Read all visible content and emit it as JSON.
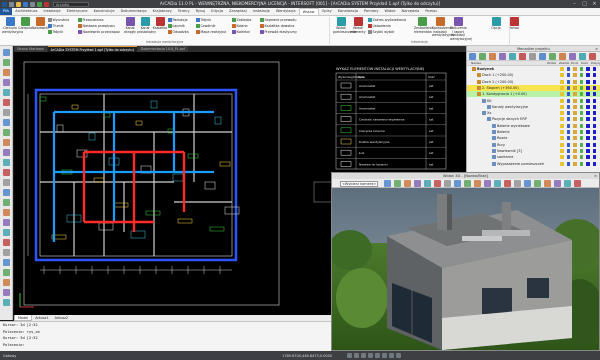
{
  "app": {
    "title": "ArCADia 11.0 PL - WEWNĘTRZNA, NIEKOMERCYJNA LICENCJA - INTERSOFT [001] - [ArCADia SYSTEM Przykład 1.apf (Tylko do odczytu)]",
    "search_value": "Arcadia"
  },
  "ribbon_tabs": [
    "Plik",
    "Architektura",
    "Instalacje",
    "Elektryczne",
    "Konstrukcje",
    "Dokumentacja",
    "Krajobrazy",
    "Tereny",
    "Rysuj",
    "Edycja",
    "Zarządzaj",
    "Instalacje",
    "Wentylacja",
    "Wstaw",
    "Opisy",
    "Kanalizacja",
    "Pomiary",
    "Widok",
    "Narzędzia",
    "Pomoc",
    "Inwentaryzacja",
    "Wymiarowanie",
    "Widok",
    "Pomoc",
    "Widok",
    "Wyświetlanie"
  ],
  "ribbon": {
    "buttons_left": [
      {
        "label": "Centrala wentylacyjna",
        "icon": "ventilation-unit-icon"
      },
      {
        "label": "Czerpnia",
        "icon": "air-intake-icon"
      },
      {
        "label": "Nawiewnik",
        "icon": "diffuser-icon"
      }
    ],
    "col1": [
      {
        "label": "Wyrzutnia",
        "icon": "exhaust-icon"
      },
      {
        "label": "Tłumik",
        "icon": "silencer-icon"
      },
      {
        "label": "Trójnik",
        "icon": "tee-icon"
      }
    ],
    "col2": [
      {
        "label": "Przepustnica",
        "icon": "damper-icon"
      },
      {
        "label": "Nastawa przepływu",
        "icon": "flow-setting-icon"
      },
      {
        "label": "Nawiewnik przeciwpożarowy",
        "icon": "fire-damper-icon"
      }
    ],
    "mid_buttons": [
      {
        "label": "Kanał okrągły",
        "icon": "round-duct-icon"
      },
      {
        "label": "Kanał prostokątny",
        "icon": "rect-duct-icon"
      },
      {
        "label": "Kształtka",
        "icon": "fitting-icon"
      }
    ],
    "col3": [
      {
        "label": "Redukcja",
        "icon": "reduction-icon"
      },
      {
        "label": "Łącznik",
        "icon": "connector-icon"
      },
      {
        "label": "Odsadzka",
        "icon": "offset-icon"
      }
    ],
    "col4": [
      {
        "label": "Trójnik",
        "icon": "tee2-icon"
      },
      {
        "label": "Czwórnik",
        "icon": "cross-icon"
      },
      {
        "label": "Mapa rewizyjna",
        "icon": "inspection-icon"
      }
    ],
    "col5": [
      {
        "label": "Zaślepka",
        "icon": "cap-icon"
      },
      {
        "label": "Kolano",
        "icon": "elbow-icon"
      },
      {
        "label": "Kolektor",
        "icon": "collector-icon"
      }
    ],
    "col6": [
      {
        "label": "Segment przewodu",
        "icon": "segment-icon"
      },
      {
        "label": "Kształtka dowolna",
        "icon": "custom-fitting-icon"
      },
      {
        "label": "Przewód elastyczny",
        "icon": "flexible-duct-icon"
      }
    ],
    "group_label_installation": "Instalacja wentylacyjna",
    "edit_buttons": [
      {
        "label": "Widok pomieszczenie",
        "icon": "room-view-icon"
      },
      {
        "label": "Widok elementy",
        "icon": "elements-view-icon"
      }
    ],
    "col7": [
      {
        "label": "Zakres wyświetlania",
        "icon": "display-range-icon"
      },
      {
        "label": "Ustawienia",
        "icon": "settings-icon"
      },
      {
        "label": "Szybki wybór",
        "icon": "quick-select-icon"
      }
    ],
    "right_buttons": [
      {
        "label": "Zestawienie elementów",
        "icon": "bill-icon"
      },
      {
        "label": "Sprawdzenie instalacji wentylacyjnej",
        "icon": "check-icon"
      },
      {
        "label": "Obliczenia i raport instalacji wentylacyjnej",
        "icon": "report-icon"
      },
      {
        "label": "Opcje",
        "icon": "options-icon"
      },
      {
        "label": "Pomoc",
        "icon": "help-icon"
      }
    ],
    "group_label_info": "Informacje"
  },
  "doc_tabs": [
    "Strona Startowa",
    "ArCADia SYSTEM Przykład 1.apf (Tylko do odczytu)",
    "Dokumentacja 10.0_PL.apf"
  ],
  "active_doc_tab": 1,
  "drawing": {
    "legend_title": "WYKAZ ELEMENTÓW INSTALACJI WENTYLACYJNEJ",
    "legend_headers": [
      "Wyszczególnienie",
      "Opis",
      "Ilość"
    ],
    "legend_rows": [
      {
        "desc": "Anemostat",
        "qty": "szt"
      },
      {
        "desc": "Anemostat",
        "qty": "szt"
      },
      {
        "desc": "Anemostat",
        "qty": "szt"
      },
      {
        "desc": "Centrala nawiewno-wywiewna",
        "qty": "szt"
      },
      {
        "desc": "Czerpnia ścienna",
        "qty": "szt"
      },
      {
        "desc": "Kratka wentylacyjna",
        "qty": "szt"
      },
      {
        "desc": "Łuk",
        "qty": "szt"
      },
      {
        "desc": "Nawiew do łazienki",
        "qty": "szt"
      }
    ]
  },
  "navigator": {
    "title": "Menadżer projektu",
    "columns": [
      "Nazwa",
      "Widok",
      "Zablok.",
      "Druk",
      "Kolor",
      "Pozycja"
    ],
    "tree": [
      {
        "label": "Budynek",
        "indent": 1,
        "style": "bold"
      },
      {
        "label": "Dach 1 (+200.00)",
        "indent": 2,
        "style": ""
      },
      {
        "label": "Dach 2 (+200.00)",
        "indent": 2,
        "style": ""
      },
      {
        "label": "2. Stopień (+360.00)",
        "indent": 2,
        "style": "sel"
      },
      {
        "label": "1. Kondygnacja 1 (+0.00)",
        "indent": 2,
        "style": "green"
      },
      {
        "label": "KK",
        "indent": 3,
        "style": ""
      },
      {
        "label": "Kanały wentylacyjne",
        "indent": 4,
        "style": ""
      },
      {
        "label": "Xx",
        "indent": 3,
        "style": ""
      },
      {
        "label": "Pozycje danych ERP",
        "indent": 4,
        "style": ""
      },
      {
        "label": "Baterie wyciekowe",
        "indent": 5,
        "style": ""
      },
      {
        "label": "Baterie",
        "indent": 5,
        "style": ""
      },
      {
        "label": "Rozdz",
        "indent": 5,
        "style": ""
      },
      {
        "label": "Rury",
        "indent": 5,
        "style": ""
      },
      {
        "label": "Nawiewnik [3]",
        "indent": 5,
        "style": ""
      },
      {
        "label": "sanitarne",
        "indent": 5,
        "style": ""
      },
      {
        "label": "Wyposażenie pomieszczeń",
        "indent": 5,
        "style": ""
      }
    ]
  },
  "view3d": {
    "title": "Widok 3D - [Nazwa/Brak]",
    "view_select": "<Wybierz kamerę>"
  },
  "sheet_tabs": [
    "Model",
    "Arkusz1",
    "Arkusz2"
  ],
  "command_lines": [
    "Kursor: 3d [2:32",
    "Polecenie: rys_on",
    "Kursor: 3d [2:32",
    "Polecenie:"
  ],
  "status": {
    "left": "Gotowy",
    "coords": "1789.6700,446.6473,0.0000"
  },
  "colors": {
    "accent_ribbon": "#1e5799",
    "selected_row": "#f7e44e",
    "green_row": "#b8f2a6"
  }
}
